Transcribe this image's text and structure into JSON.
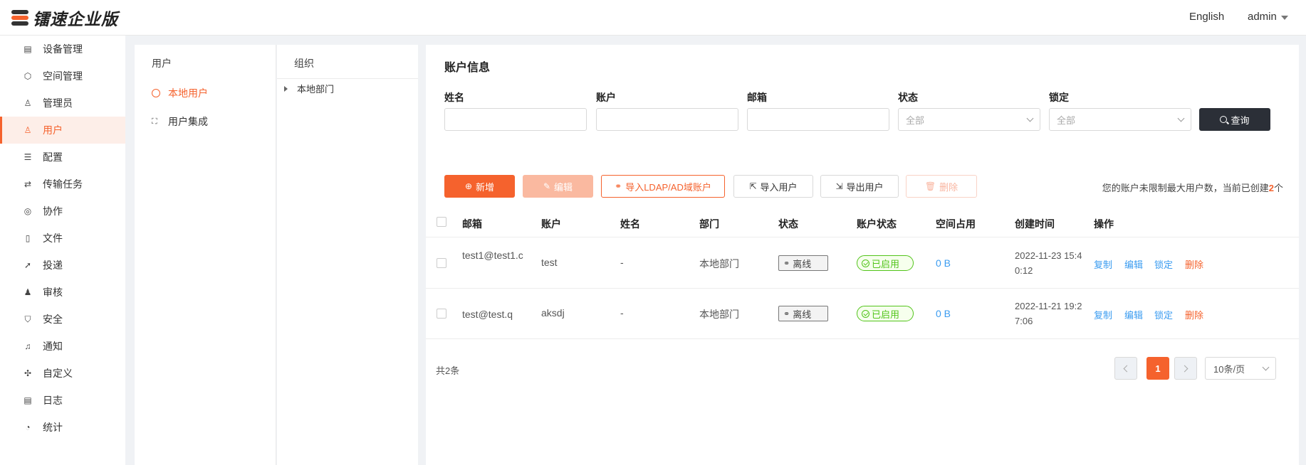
{
  "header": {
    "logo_text": "镭速企业版",
    "language": "English",
    "user": "admin"
  },
  "sidebar": {
    "items": [
      {
        "label": "设备管理",
        "icon": "device-icon"
      },
      {
        "label": "空间管理",
        "icon": "space-icon"
      },
      {
        "label": "管理员",
        "icon": "admin-icon"
      },
      {
        "label": "用户",
        "icon": "user-icon",
        "active": true
      },
      {
        "label": "配置",
        "icon": "config-icon"
      },
      {
        "label": "传输任务",
        "icon": "transfer-icon"
      },
      {
        "label": "协作",
        "icon": "collab-icon"
      },
      {
        "label": "文件",
        "icon": "file-icon"
      },
      {
        "label": "投递",
        "icon": "send-icon"
      },
      {
        "label": "审核",
        "icon": "audit-icon"
      },
      {
        "label": "安全",
        "icon": "shield-icon"
      },
      {
        "label": "通知",
        "icon": "bell-icon"
      },
      {
        "label": "自定义",
        "icon": "puzzle-icon"
      },
      {
        "label": "日志",
        "icon": "log-icon"
      },
      {
        "label": "统计",
        "icon": "chart-icon"
      }
    ]
  },
  "users_panel": {
    "title": "用户",
    "items": [
      "本地用户",
      "用户集成"
    ]
  },
  "org_panel": {
    "title": "组织",
    "root": "本地部门"
  },
  "main": {
    "title": "账户信息",
    "filters": {
      "name_label": "姓名",
      "account_label": "账户",
      "email_label": "邮箱",
      "status_label": "状态",
      "status_value": "全部",
      "lock_label": "锁定",
      "lock_value": "全部",
      "query_button": "查询"
    },
    "toolbar": {
      "new": "新增",
      "edit": "编辑",
      "import_ldap": "导入LDAP/AD域账户",
      "import_users": "导入用户",
      "export_users": "导出用户",
      "delete": "删除"
    },
    "limit_note_prefix": "您的账户未限制最大用户数，当前已创建",
    "limit_count": "2",
    "limit_note_suffix": "个",
    "table": {
      "columns": [
        "邮箱",
        "账户",
        "姓名",
        "部门",
        "状态",
        "账户状态",
        "空间占用",
        "创建时间",
        "操作"
      ],
      "rows": [
        {
          "email": "test1@test1.c",
          "account": "test",
          "name": "-",
          "dept": "本地部门",
          "status": "离线",
          "account_status": "已启用",
          "usage": "0 B",
          "created": "2022-11-23 15:40:12"
        },
        {
          "email": "test@test.q",
          "account": "aksdj",
          "name": "-",
          "dept": "本地部门",
          "status": "离线",
          "account_status": "已启用",
          "usage": "0 B",
          "created": "2022-11-21 19:27:06"
        }
      ],
      "actions": [
        "复制",
        "编辑",
        "锁定",
        "删除"
      ]
    },
    "pager": {
      "total": "共2条",
      "current": "1",
      "page_size": "10条/页"
    }
  }
}
